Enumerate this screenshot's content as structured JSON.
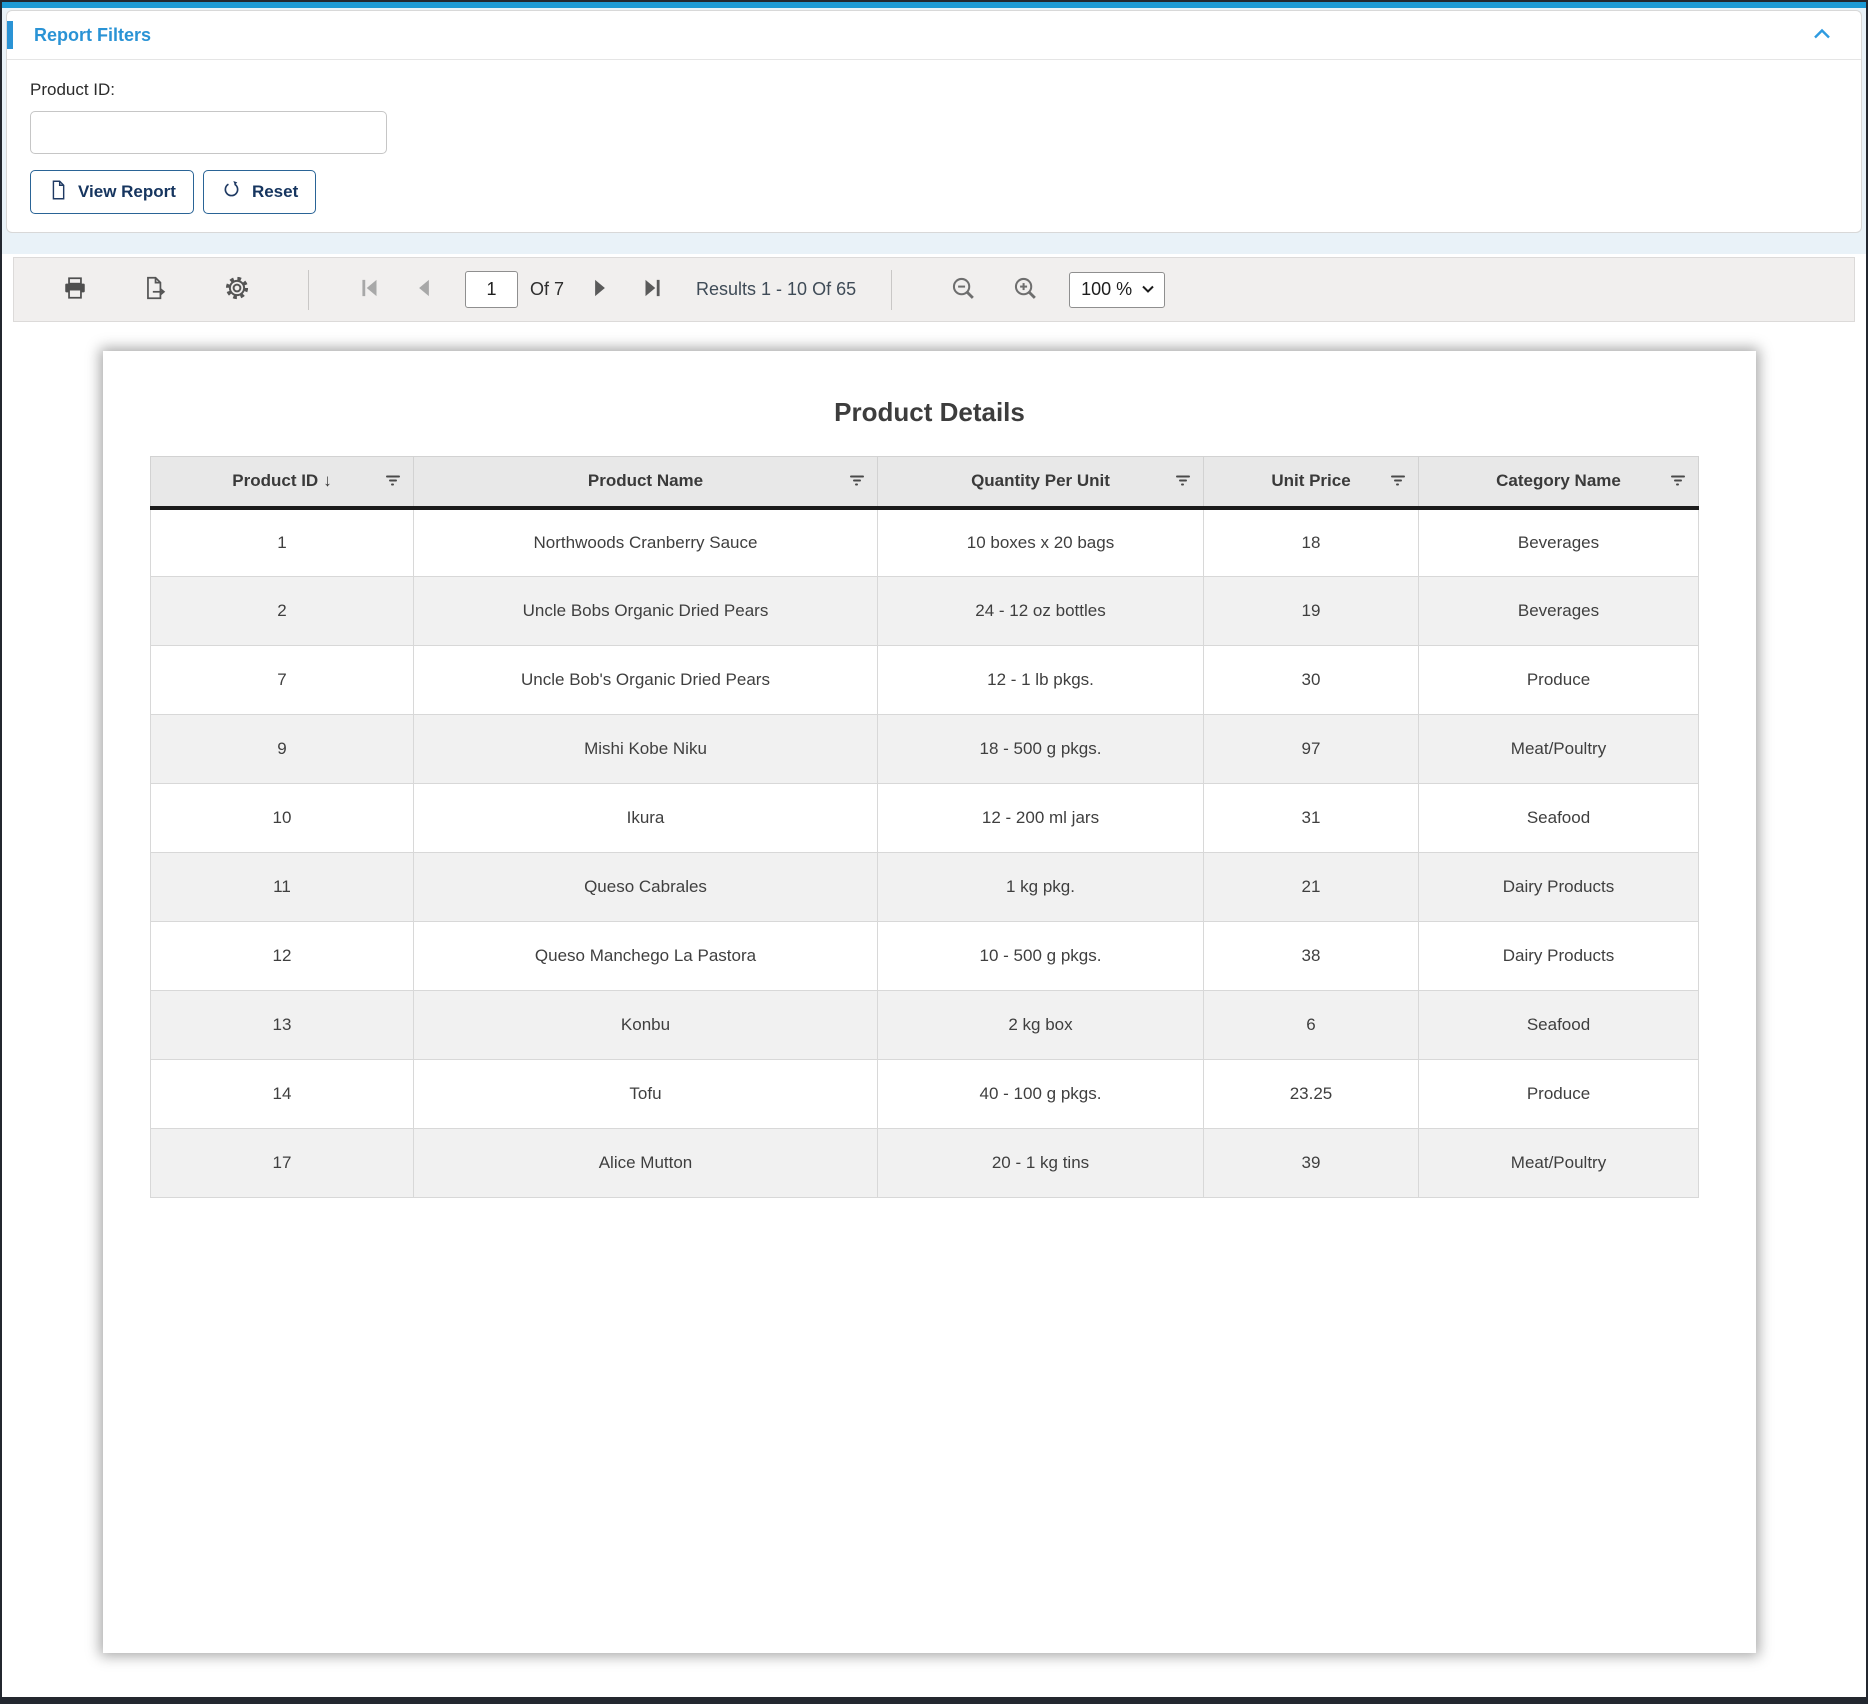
{
  "filters_panel": {
    "title": "Report Filters",
    "product_id_label": "Product ID:",
    "product_id_value": "",
    "view_report_label": "View Report",
    "reset_label": "Reset"
  },
  "toolbar": {
    "page_value": "1",
    "of_label": "Of 7",
    "results_label": "Results 1 - 10 Of 65",
    "zoom_value": "100 %"
  },
  "report": {
    "title": "Product Details",
    "table": {
      "sort_indicator": "↓",
      "columns": [
        {
          "label": "Product ID"
        },
        {
          "label": "Product Name"
        },
        {
          "label": "Quantity Per Unit"
        },
        {
          "label": "Unit Price"
        },
        {
          "label": "Category Name"
        }
      ],
      "rows": [
        [
          "1",
          "Northwoods Cranberry Sauce",
          "10 boxes x 20 bags",
          "18",
          "Beverages"
        ],
        [
          "2",
          "Uncle Bobs Organic Dried Pears",
          "24 - 12 oz bottles",
          "19",
          "Beverages"
        ],
        [
          "7",
          "Uncle Bob's Organic Dried Pears",
          "12 - 1 lb pkgs.",
          "30",
          "Produce"
        ],
        [
          "9",
          "Mishi Kobe Niku",
          "18 - 500 g pkgs.",
          "97",
          "Meat/Poultry"
        ],
        [
          "10",
          "Ikura",
          "12 - 200 ml jars",
          "31",
          "Seafood"
        ],
        [
          "11",
          "Queso Cabrales",
          "1 kg pkg.",
          "21",
          "Dairy Products"
        ],
        [
          "12",
          "Queso Manchego La Pastora",
          "10 - 500 g pkgs.",
          "38",
          "Dairy Products"
        ],
        [
          "13",
          "Konbu",
          "2 kg box",
          "6",
          "Seafood"
        ],
        [
          "14",
          "Tofu",
          "40 - 100 g pkgs.",
          "23.25",
          "Produce"
        ],
        [
          "17",
          "Alice Mutton",
          "20 - 1 kg tins",
          "39",
          "Meat/Poultry"
        ]
      ]
    }
  },
  "icons": {
    "collapse": "chevron-up-icon",
    "view_report": "document-icon",
    "reset": "refresh-icon",
    "toolbar": [
      "print-icon",
      "export-icon",
      "settings-icon",
      "first-page-icon",
      "previous-page-icon",
      "next-page-icon",
      "last-page-icon",
      "zoom-out-icon",
      "zoom-in-icon",
      "dropdown-chevron-icon"
    ],
    "column_filter": "filter-icon",
    "sort": "sort-descending-arrow"
  },
  "colors": {
    "top_border_blue": "#1d9ad5",
    "accent_blue": "#2a93d5",
    "button_border_blue": "#2a6496",
    "button_navy_text": "#16355f",
    "toolbar_bg": "#f1efee",
    "header_bg": "#e8e8e8",
    "row_alt_bg": "#f1f1f1"
  }
}
